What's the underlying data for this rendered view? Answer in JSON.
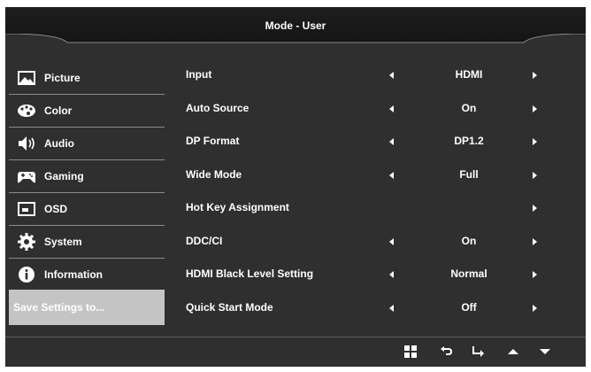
{
  "header": {
    "title": "Mode - User"
  },
  "sidebar": {
    "items": [
      {
        "label": "Picture",
        "icon": "picture-icon"
      },
      {
        "label": "Color",
        "icon": "palette-icon"
      },
      {
        "label": "Audio",
        "icon": "speaker-icon"
      },
      {
        "label": "Gaming",
        "icon": "gamepad-icon"
      },
      {
        "label": "OSD",
        "icon": "osd-icon"
      },
      {
        "label": "System",
        "icon": "gear-icon"
      },
      {
        "label": "Information",
        "icon": "info-icon"
      }
    ],
    "save_label": "Save Settings to..."
  },
  "settings": [
    {
      "name": "Input",
      "value": "HDMI"
    },
    {
      "name": "Auto Source",
      "value": "On"
    },
    {
      "name": "DP Format",
      "value": "DP1.2"
    },
    {
      "name": "Wide Mode",
      "value": "Full"
    },
    {
      "name": "Hot Key Assignment",
      "value": ""
    },
    {
      "name": "DDC/CI",
      "value": "On"
    },
    {
      "name": "HDMI Black Level Setting",
      "value": "Normal"
    },
    {
      "name": "Quick Start Mode",
      "value": "Off"
    }
  ],
  "bottom_bar": {
    "buttons": [
      "menu-grid-icon",
      "back-icon",
      "enter-icon",
      "up-arrow-icon",
      "down-arrow-icon"
    ]
  },
  "colors": {
    "panel": "#2f2f2f",
    "header": "#161616",
    "selected": "#c4c4c4",
    "text": "#ffffff"
  }
}
